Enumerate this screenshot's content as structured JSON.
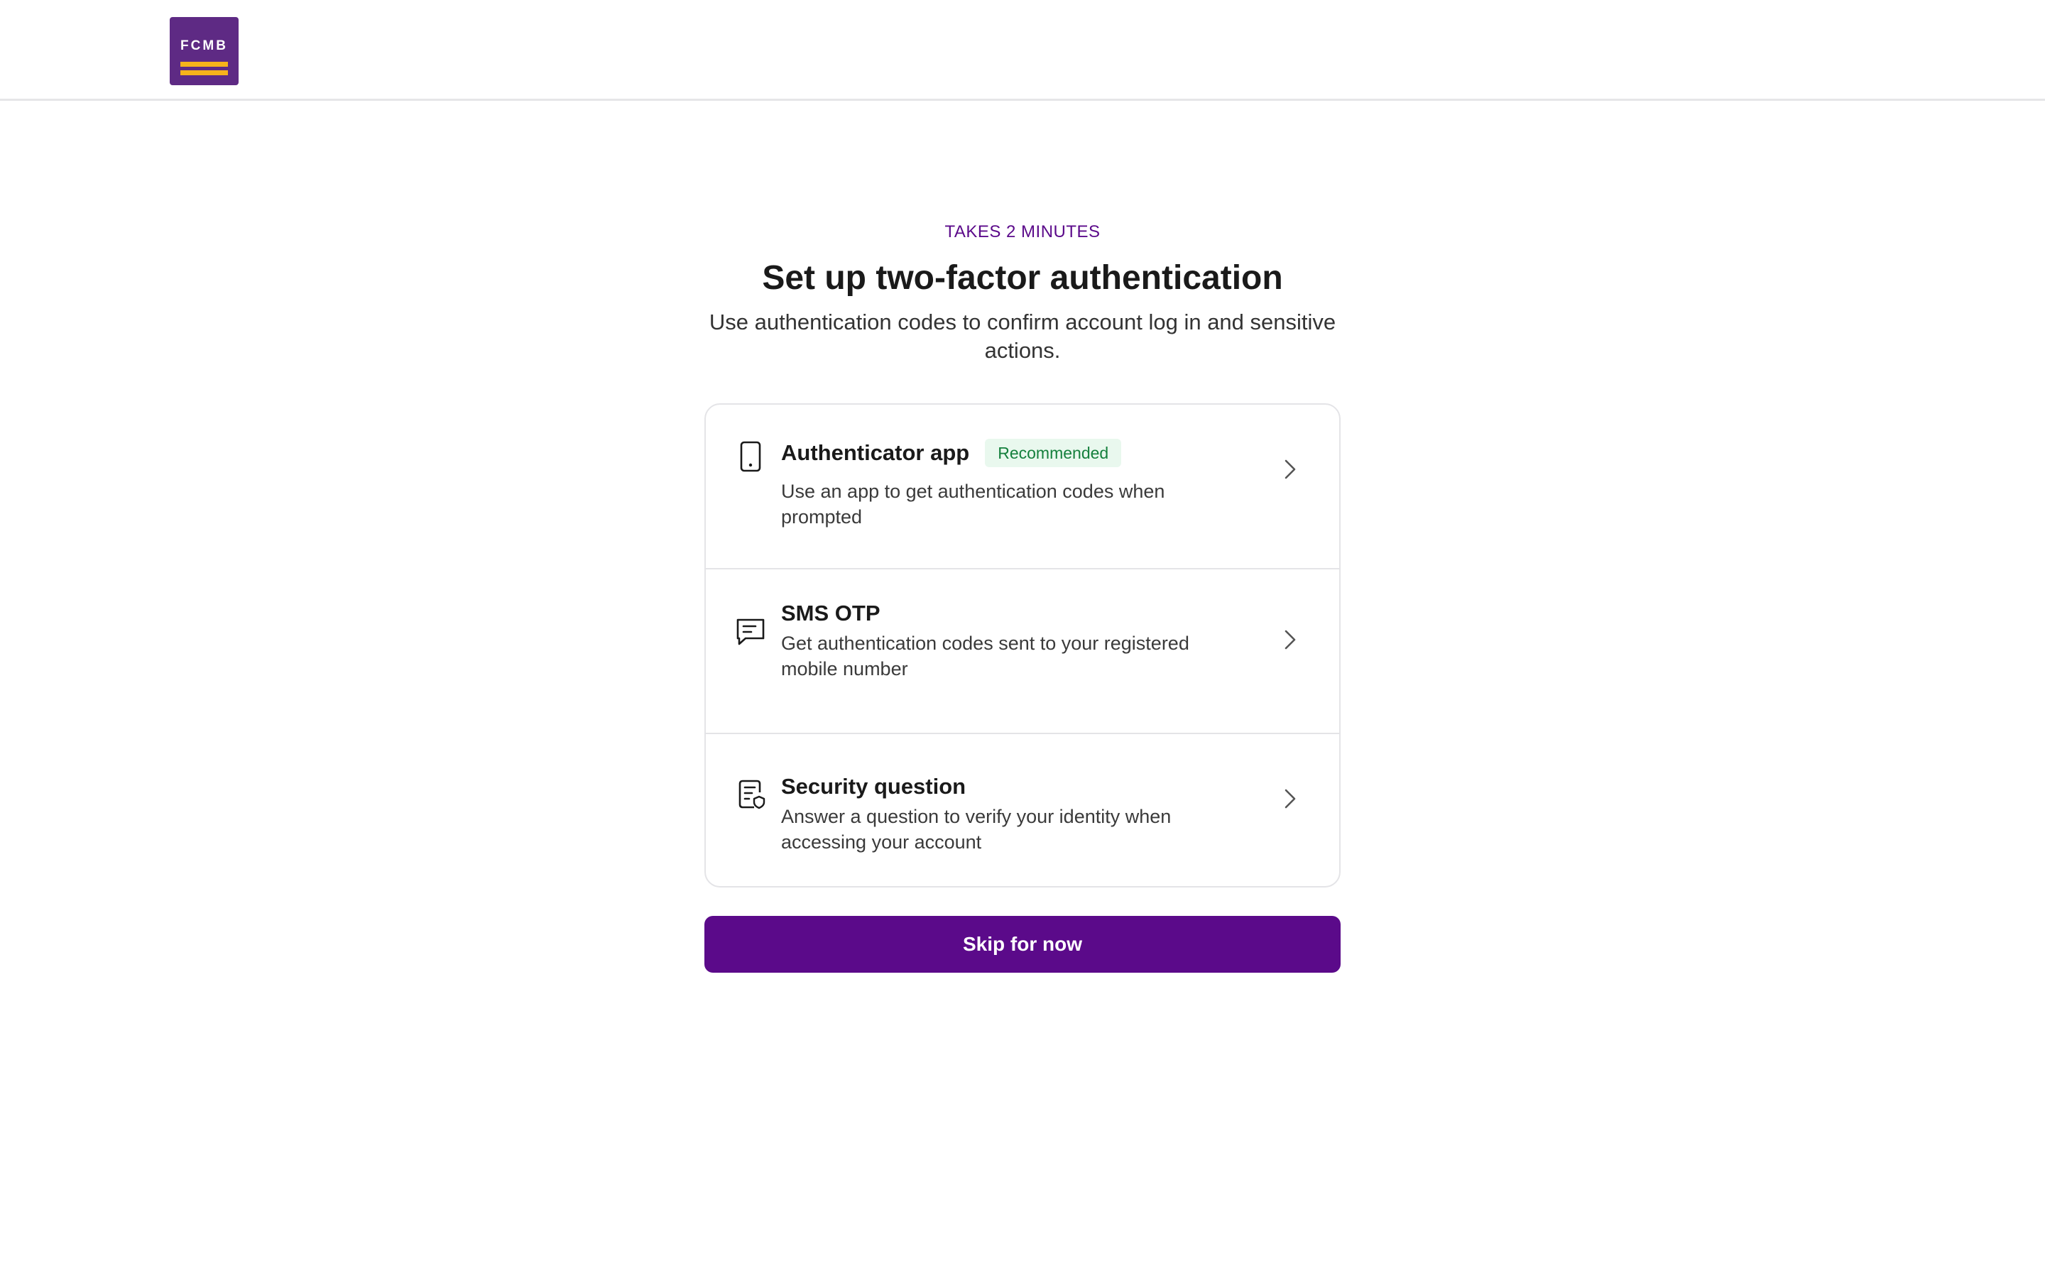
{
  "header": {
    "logo_text": "FCMB",
    "logo_colors": {
      "background": "#5e2a84",
      "bars": "#f6b21b"
    }
  },
  "intro": {
    "eyebrow": "TAKES 2 MINUTES",
    "title": "Set up two-factor authentication",
    "subtitle": "Use authentication codes to confirm account log in and sensitive actions."
  },
  "options": [
    {
      "icon": "smartphone-icon",
      "title": "Authenticator app",
      "badge": "Recommended",
      "description": "Use an app to get authentication codes when prompted"
    },
    {
      "icon": "message-icon",
      "title": "SMS OTP",
      "description": "Get authentication codes sent to your registered mobile number"
    },
    {
      "icon": "security-document-icon",
      "title": "Security question",
      "description": "Answer a question to verify your identity when accessing your account"
    }
  ],
  "actions": {
    "skip_label": "Skip for now"
  },
  "colors": {
    "primary": "#5b0a8a",
    "badge_bg": "#e9f8ee",
    "badge_text": "#15803d",
    "border": "#e4e4e7"
  }
}
